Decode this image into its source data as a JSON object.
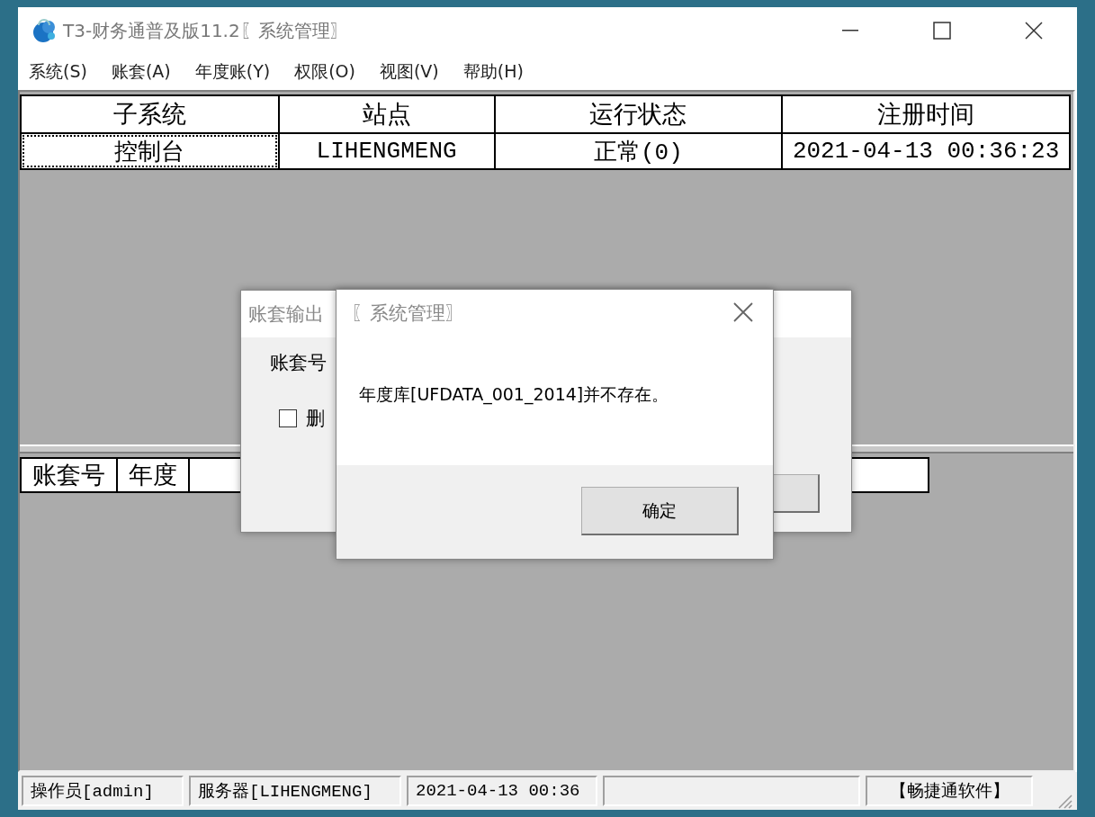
{
  "window": {
    "title": "T3-财务通普及版11.2〖系统管理〗"
  },
  "menu": [
    {
      "label": "系统(S)"
    },
    {
      "label": "账套(A)"
    },
    {
      "label": "年度账(Y)"
    },
    {
      "label": "权限(O)"
    },
    {
      "label": "视图(V)"
    },
    {
      "label": "帮助(H)"
    }
  ],
  "process_table": {
    "columns": [
      "子系统",
      "站点",
      "运行状态",
      "注册时间"
    ],
    "rows": [
      {
        "cells": [
          "控制台",
          "LIHENGMENG",
          "正常(0)",
          "2021-04-13 00:36:23"
        ],
        "selected": true
      }
    ]
  },
  "account_table": {
    "columns": [
      "账套号",
      "年度"
    ]
  },
  "status_bar": [
    {
      "text": "操作员[admin]"
    },
    {
      "text": "服务器[LIHENGMENG]"
    },
    {
      "text": "2021-04-13 00:36"
    },
    {
      "text": "【畅捷通软件】"
    }
  ],
  "export_dialog": {
    "title": "账套输出",
    "label": "账套号",
    "checkbox": {
      "label": "删",
      "checked": false
    }
  },
  "message_dialog": {
    "title": "〖系统管理〗",
    "message": "年度库[UFDATA_001_2014]并不存在。",
    "button": "确定"
  }
}
